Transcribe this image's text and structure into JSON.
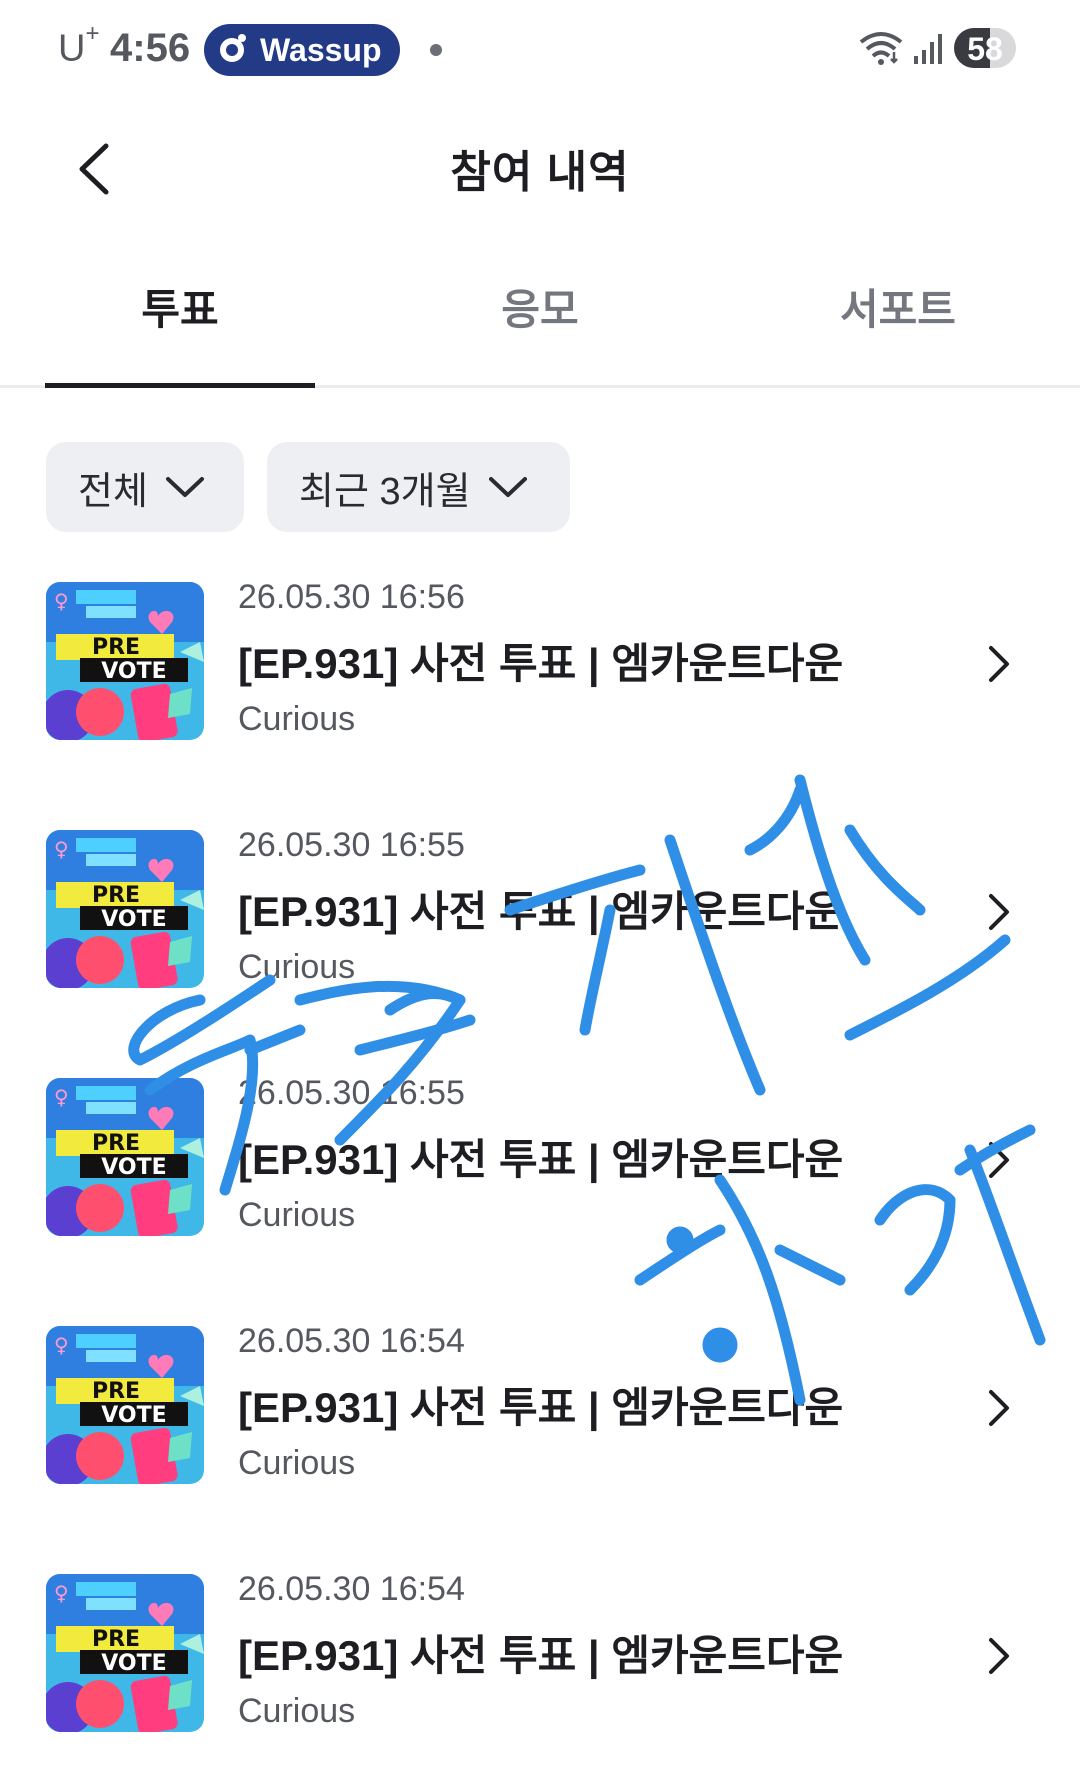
{
  "status_bar": {
    "carrier": "U",
    "carrier_sup": "+",
    "time": "4:56",
    "app_pill": "Wassup",
    "battery": "58"
  },
  "header": {
    "title": "참여 내역"
  },
  "tabs": [
    {
      "label": "투표",
      "active": true
    },
    {
      "label": "응모",
      "active": false
    },
    {
      "label": "서포트",
      "active": false
    }
  ],
  "filters": [
    {
      "label": "전체"
    },
    {
      "label": "최근 3개월"
    }
  ],
  "items": [
    {
      "date": "26.05.30 16:56",
      "title": "[EP.931] 사전 투표 | 엠카운트다운",
      "sub": "Curious",
      "thumb_text_1": "PRE",
      "thumb_text_2": "VOTE"
    },
    {
      "date": "26.05.30 16:55",
      "title": "[EP.931] 사전 투표 | 엠카운트다운",
      "sub": "Curious",
      "thumb_text_1": "PRE",
      "thumb_text_2": "VOTE"
    },
    {
      "date": "26.05.30 16:55",
      "title": "[EP.931] 사전 투표 | 엠카운트다운",
      "sub": "Curious",
      "thumb_text_1": "PRE",
      "thumb_text_2": "VOTE"
    },
    {
      "date": "26.05.30 16:54",
      "title": "[EP.931] 사전 투표 | 엠카운트다운",
      "sub": "Curious",
      "thumb_text_1": "PRE",
      "thumb_text_2": "VOTE"
    },
    {
      "date": "26.05.30 16:54",
      "title": "[EP.931] 사전 투표 | 엠카운트다운",
      "sub": "Curious",
      "thumb_text_1": "PRE",
      "thumb_text_2": "VOTE"
    }
  ],
  "colors": {
    "accent_pill": "#233a86",
    "scribble": "#2f8ee6",
    "thumb_bg": "#3fb8e8",
    "thumb_band": "#f2ea3c"
  }
}
